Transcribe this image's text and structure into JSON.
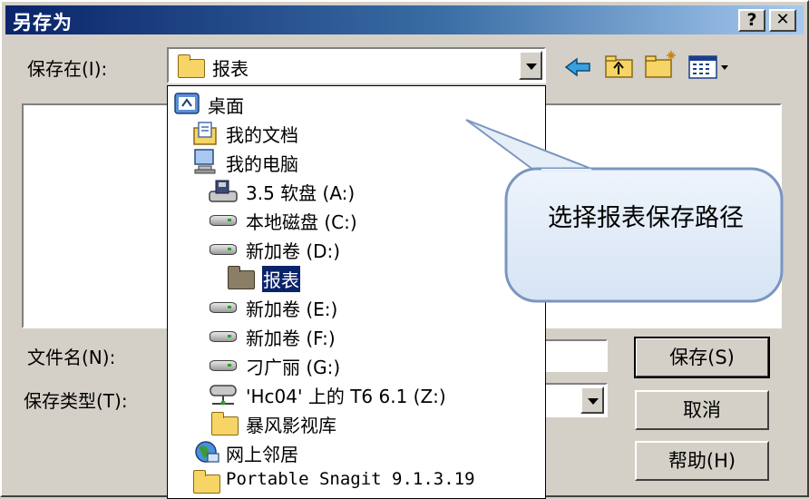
{
  "dialog": {
    "title": "另存为",
    "help_btn": "?",
    "close_btn": "✕"
  },
  "save_in": {
    "label": "保存在(I):",
    "value": "报表"
  },
  "toolbar": {
    "icons": [
      "back-icon",
      "up-folder-icon",
      "new-folder-icon",
      "view-menu-icon"
    ]
  },
  "dropdown_items": [
    {
      "label": "桌面",
      "icon": "desktop-icon",
      "level": 0
    },
    {
      "label": "我的文档",
      "icon": "my-documents-icon",
      "level": 1
    },
    {
      "label": "我的电脑",
      "icon": "my-computer-icon",
      "level": 1
    },
    {
      "label": "3.5 软盘 (A:)",
      "icon": "floppy-icon",
      "level": 2
    },
    {
      "label": "本地磁盘 (C:)",
      "icon": "drive-icon",
      "level": 2
    },
    {
      "label": "新加卷 (D:)",
      "icon": "drive-icon",
      "level": 2
    },
    {
      "label": "报表",
      "icon": "open-folder-icon",
      "level": 3,
      "selected": true
    },
    {
      "label": "新加卷 (E:)",
      "icon": "drive-icon",
      "level": 2
    },
    {
      "label": "新加卷 (F:)",
      "icon": "drive-icon",
      "level": 2
    },
    {
      "label": "刁广丽 (G:)",
      "icon": "drive-icon",
      "level": 2
    },
    {
      "label": "'Hc04' 上的 T6 6.1 (Z:)",
      "icon": "network-drive-icon",
      "level": 2
    },
    {
      "label": "暴风影视库",
      "icon": "folder-icon",
      "level": 2
    },
    {
      "label": "网上邻居",
      "icon": "network-places-icon",
      "level": 1
    },
    {
      "label": "Portable Snagit 9.1.3.19",
      "icon": "folder-icon",
      "level": 1
    }
  ],
  "filename": {
    "label": "文件名(N):",
    "value": ""
  },
  "filetype": {
    "label": "保存类型(T):",
    "value": ""
  },
  "buttons": {
    "save": "保存(S)",
    "cancel": "取消",
    "help": "帮助(H)"
  },
  "callout": {
    "text": "选择报表保存路径"
  },
  "colors": {
    "title_start": "#0a246a",
    "title_end": "#a6caf0",
    "selection": "#0a246a",
    "face": "#d4d0c8"
  }
}
